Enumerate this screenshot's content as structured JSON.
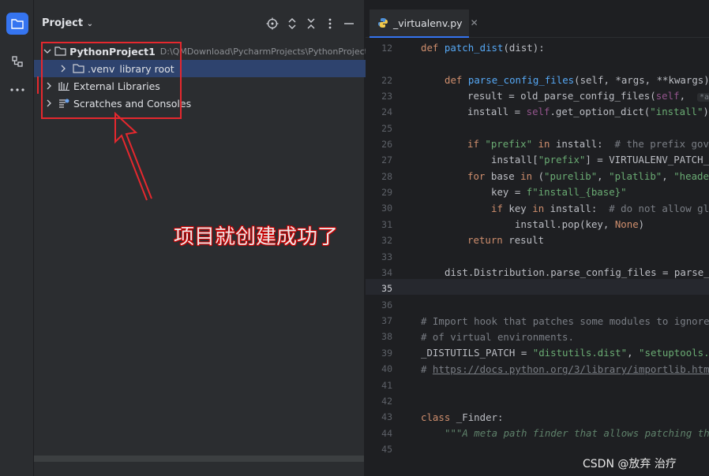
{
  "toolbar": {
    "items": [
      "project-icon",
      "structure-icon",
      "more-icon"
    ]
  },
  "panel": {
    "title": "Project",
    "header_icons": [
      "target-icon",
      "expand-icon",
      "collapse-icon",
      "kebab-icon",
      "minimize-icon"
    ],
    "tree": {
      "project_name": "PythonProject1",
      "project_path": "D:\\QMDownload\\PycharmProjects\\PythonProject1",
      "venv_label": ".venv",
      "venv_tag": "library root",
      "external_libraries": "External Libraries",
      "scratches": "Scratches and Consoles"
    }
  },
  "annotation": {
    "caption": "项目就创建成功了",
    "color": "#e5282e"
  },
  "editor": {
    "tab_label": "_virtualenv.py",
    "line_numbers": [
      "12",
      "",
      "22",
      "23",
      "24",
      "25",
      "26",
      "27",
      "28",
      "29",
      "30",
      "31",
      "32",
      "33",
      "34",
      "35",
      "36",
      "37",
      "38",
      "39",
      "40",
      "41",
      "42",
      "43",
      "44",
      "45",
      ""
    ],
    "lines": {
      "l12_def": "def",
      "l12_name": "patch_dist",
      "l12_rest": "(dist):",
      "l22_def": "def",
      "l22_name": "parse_config_files",
      "l22_rest": "(self, *args, **kwargs):",
      "l23_a": "result = old_parse_config_files(",
      "l23_self": "self",
      "l23_b": ",",
      "l23_hint": "*args",
      "l24_a": "install = ",
      "l24_self": "self",
      "l24_b": ".get_option_dict(",
      "l24_str": "\"install\"",
      "l24_c": ")",
      "l26_if": "if",
      "l26_str": "\"prefix\"",
      "l26_in": "in",
      "l26_b": "install:",
      "l26_cm": "# the prefix gove",
      "l27_a": "install[",
      "l27_str": "\"prefix\"",
      "l27_b": "] = VIRTUALENV_PATCH_F",
      "l28_for": "for",
      "l28_a": "base",
      "l28_in": "in",
      "l28_b": "(",
      "l28_s1": "\"purelib\"",
      "l28_c": ",",
      "l28_s2": "\"platlib\"",
      "l28_d": ",",
      "l28_s3": "\"header",
      "l29_a": "key = ",
      "l29_str": "f\"install_{base}\"",
      "l30_if": "if",
      "l30_a": "key",
      "l30_in": "in",
      "l30_b": "install:",
      "l30_cm": "# do not allow gl",
      "l31_a": "install.pop(key,",
      "l31_kw": "None",
      "l31_b": ")",
      "l32_ret": "return",
      "l32_a": "result",
      "l34_a": "dist.Distribution.parse_config_files = parse_c",
      "l37_cm": "# Import hook that patches some modules to ignore",
      "l38_cm": "# of virtual environments.",
      "l39_a": "_DISTUTILS_PATCH = ",
      "l39_s1": "\"distutils.dist\"",
      "l39_b": ",",
      "l39_s2": "\"setuptools.d",
      "l40_cm": "# ",
      "l40_link": "https://docs.python.org/3/library/importlib.html",
      "l43_class": "class",
      "l43_name": "_Finder:",
      "l44_doc": "\"\"\"A meta path finder that allows patching the"
    }
  },
  "watermark": "CSDN @放弃     治疗"
}
